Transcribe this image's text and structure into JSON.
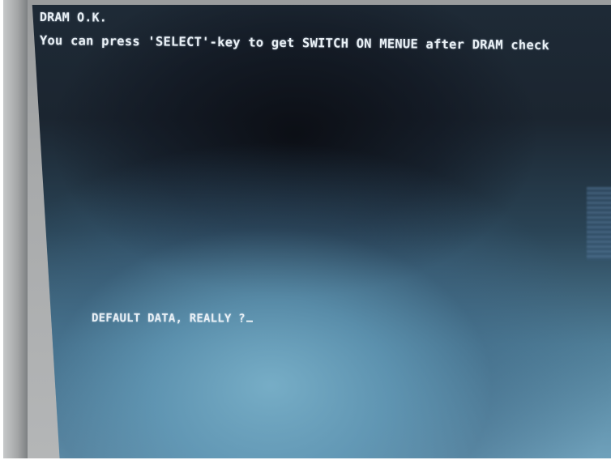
{
  "screen": {
    "status_line": "DRAM O.K.",
    "info_line": "You can press 'SELECT'-key to get SWITCH ON MENUE after DRAM check",
    "prompt": "DEFAULT DATA, REALLY ?"
  },
  "colors": {
    "screen_dark": "#1b2530",
    "screen_glow": "#6fa1bb",
    "text": "#e9f0f5",
    "bezel": "#a8aaab"
  },
  "icons": {
    "cursor": "text-cursor-underscore"
  }
}
